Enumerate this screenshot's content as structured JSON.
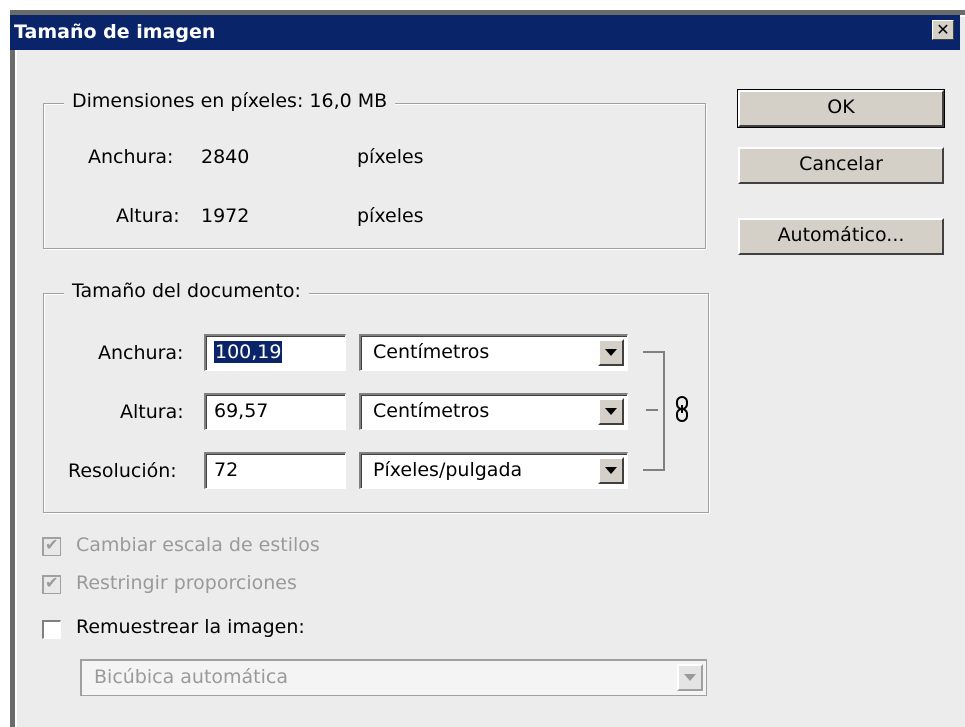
{
  "window": {
    "title": "Tamaño de imagen",
    "close_glyph": "✕"
  },
  "pixel_dimensions": {
    "legend": "Dimensiones en píxeles: 16,0 MB",
    "width_label": "Anchura:",
    "width_value": "2840",
    "width_unit": "píxeles",
    "height_label": "Altura:",
    "height_value": "1972",
    "height_unit": "píxeles"
  },
  "document_size": {
    "legend": "Tamaño del documento:",
    "width_label": "Anchura:",
    "width_value": "100,19",
    "width_unit": "Centímetros",
    "height_label": "Altura:",
    "height_value": "69,57",
    "height_unit": "Centímetros",
    "resolution_label": "Resolución:",
    "resolution_value": "72",
    "resolution_unit": "Píxeles/pulgada",
    "link_icon": "chain-link-icon"
  },
  "buttons": {
    "ok": "OK",
    "cancel": "Cancelar",
    "auto": "Automático..."
  },
  "options": {
    "scale_styles": {
      "label": "Cambiar escala de estilos",
      "checked": true,
      "enabled": false
    },
    "constrain": {
      "label": "Restringir proporciones",
      "checked": true,
      "enabled": false
    },
    "resample": {
      "label": "Remuestrear la imagen:",
      "checked": false,
      "enabled": true
    },
    "resample_method": "Bicúbica automática"
  },
  "colors": {
    "titlebar": "#0a246a",
    "dialog_bg": "#ececec",
    "disabled_text": "#9a9a9a"
  }
}
